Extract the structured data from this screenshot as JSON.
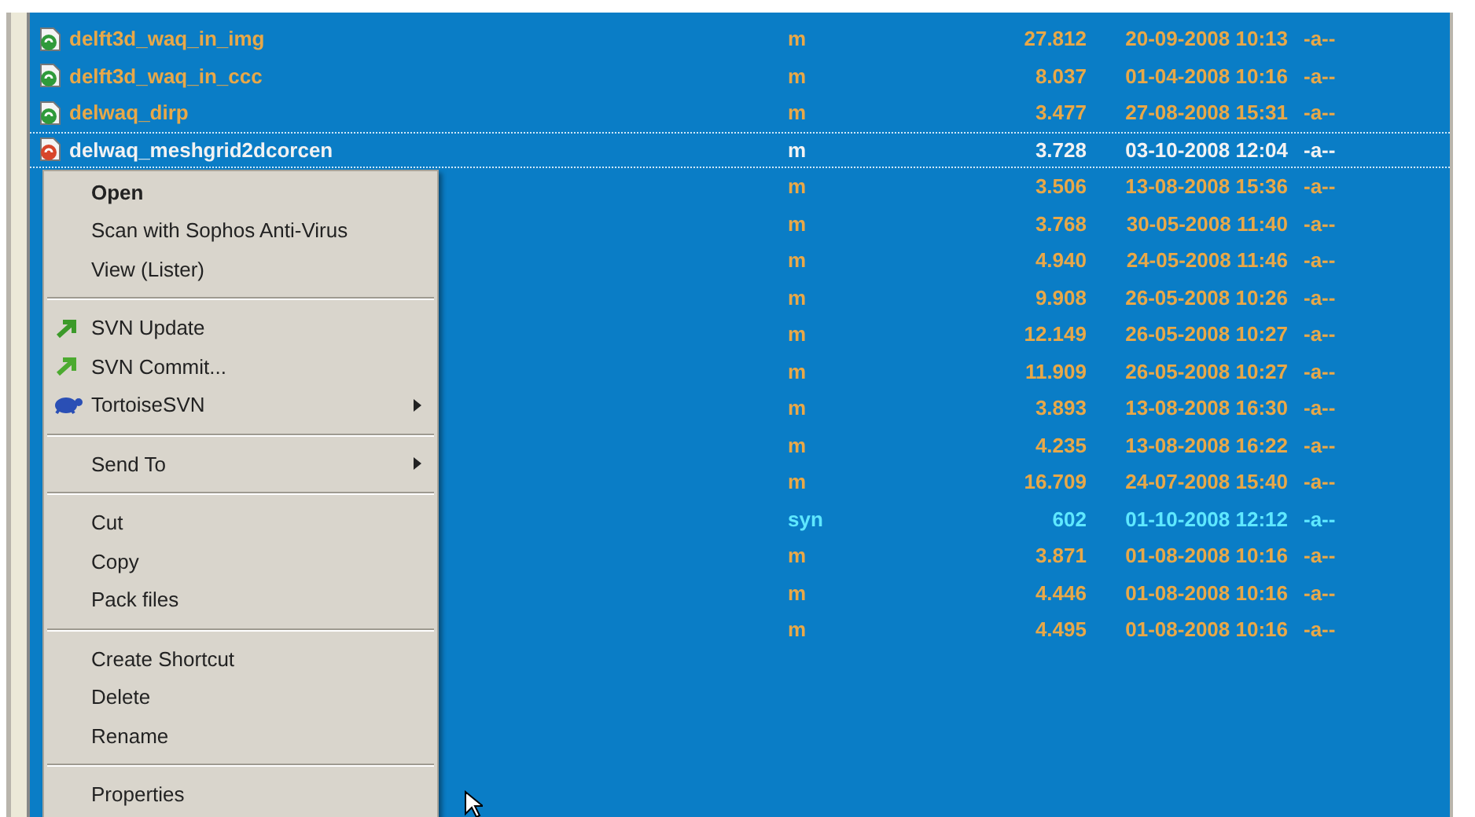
{
  "files": [
    {
      "name": "delft3d_waq_in_img",
      "kind": "versioned",
      "ext": "m",
      "size": "27.812",
      "date": "20-09-2008 10:13",
      "attr": "-a--",
      "color": "#e8a848",
      "cursor": false
    },
    {
      "name": "delft3d_waq_in_ccc",
      "kind": "versioned",
      "ext": "m",
      "size": "8.037",
      "date": "01-04-2008 10:16",
      "attr": "-a--",
      "color": "#e8a848",
      "cursor": false
    },
    {
      "name": "delwaq_dirp",
      "kind": "versioned",
      "ext": "m",
      "size": "3.477",
      "date": "27-08-2008 15:31",
      "attr": "-a--",
      "color": "#e8a848",
      "cursor": false
    },
    {
      "name": "delwaq_meshgrid2dcorcen",
      "kind": "changed",
      "ext": "m",
      "size": "3.728",
      "date": "03-10-2008 12:04",
      "attr": "-a--",
      "color": "#f2f2f2",
      "cursor": true
    },
    {
      "ext": "m",
      "size": "3.506",
      "date": "13-08-2008 15:36",
      "attr": "-a--",
      "color": "#e8a848",
      "cursor": false
    },
    {
      "ext": "m",
      "size": "3.768",
      "date": "30-05-2008 11:40",
      "attr": "-a--",
      "color": "#e8a848",
      "cursor": false
    },
    {
      "ext": "m",
      "size": "4.940",
      "date": "24-05-2008 11:46",
      "attr": "-a--",
      "color": "#e8a848",
      "cursor": false
    },
    {
      "ext": "m",
      "size": "9.908",
      "date": "26-05-2008 10:26",
      "attr": "-a--",
      "color": "#e8a848",
      "cursor": false
    },
    {
      "ext": "m",
      "size": "12.149",
      "date": "26-05-2008 10:27",
      "attr": "-a--",
      "color": "#e8a848",
      "cursor": false
    },
    {
      "ext": "m",
      "size": "11.909",
      "date": "26-05-2008 10:27",
      "attr": "-a--",
      "color": "#e8a848",
      "cursor": false
    },
    {
      "ext": "m",
      "size": "3.893",
      "date": "13-08-2008 16:30",
      "attr": "-a--",
      "color": "#e8a848",
      "cursor": false
    },
    {
      "ext": "m",
      "size": "4.235",
      "date": "13-08-2008 16:22",
      "attr": "-a--",
      "color": "#e8a848",
      "cursor": false
    },
    {
      "ext": "m",
      "size": "16.709",
      "date": "24-07-2008 15:40",
      "attr": "-a--",
      "color": "#e8a848",
      "cursor": false
    },
    {
      "ext": "syn",
      "size": "602",
      "date": "01-10-2008 12:12",
      "attr": "-a--",
      "color": "#5fe8ff",
      "cursor": false
    },
    {
      "ext": "m",
      "size": "3.871",
      "date": "01-08-2008 10:16",
      "attr": "-a--",
      "color": "#e8a848",
      "cursor": false
    },
    {
      "ext": "m",
      "size": "4.446",
      "date": "01-08-2008 10:16",
      "attr": "-a--",
      "color": "#e8a848",
      "cursor": false
    },
    {
      "ext": "m",
      "size": "4.495",
      "date": "01-08-2008 10:16",
      "attr": "-a--",
      "color": "#e8a848",
      "cursor": false
    }
  ],
  "context_menu": [
    {
      "kind": "plain",
      "label": "Open",
      "default": true
    },
    {
      "kind": "plain",
      "label": "Scan with Sophos Anti-Virus",
      "default": false
    },
    {
      "kind": "plain",
      "label": "View (Lister)",
      "default": false
    },
    {
      "kind": "separator"
    },
    {
      "kind": "update",
      "label": "SVN Update",
      "default": false
    },
    {
      "kind": "commit",
      "label": "SVN Commit...",
      "default": false
    },
    {
      "kind": "tortoise",
      "label": "TortoiseSVN",
      "submenu": true,
      "default": false
    },
    {
      "kind": "separator"
    },
    {
      "kind": "plain",
      "label": "Send To",
      "submenu": true,
      "default": false
    },
    {
      "kind": "separator"
    },
    {
      "kind": "plain",
      "label": "Cut",
      "default": false
    },
    {
      "kind": "plain",
      "label": "Copy",
      "default": false
    },
    {
      "kind": "plain",
      "label": "Pack files",
      "default": false
    },
    {
      "kind": "separator"
    },
    {
      "kind": "plain",
      "label": "Create Shortcut",
      "default": false
    },
    {
      "kind": "plain",
      "label": "Delete",
      "default": false
    },
    {
      "kind": "plain",
      "label": "Rename",
      "default": false
    },
    {
      "kind": "separator"
    },
    {
      "kind": "plain",
      "label": "Properties",
      "default": false
    }
  ]
}
